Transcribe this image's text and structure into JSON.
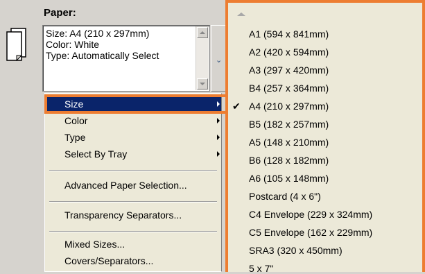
{
  "paper": {
    "label": "Paper:",
    "info_lines": [
      "Size: A4 (210 x 297mm)",
      "Color: White",
      "Type: Automatically Select"
    ]
  },
  "menu": {
    "items": [
      {
        "label": "Size",
        "submenu": true,
        "selected": true
      },
      {
        "label": "Color",
        "submenu": true
      },
      {
        "label": "Type",
        "submenu": true
      },
      {
        "label": "Select By Tray",
        "submenu": true
      },
      {
        "label": "Advanced Paper Selection..."
      },
      {
        "label": "Transparency Separators..."
      },
      {
        "label": "Mixed Sizes..."
      },
      {
        "label": "Covers/Separators..."
      }
    ]
  },
  "size_submenu": {
    "items": [
      {
        "label": "A1 (594 x 841mm)"
      },
      {
        "label": "A2 (420 x 594mm)"
      },
      {
        "label": "A3 (297 x 420mm)"
      },
      {
        "label": "B4 (257 x 364mm)"
      },
      {
        "label": "A4 (210 x 297mm)",
        "checked": true
      },
      {
        "label": "B5 (182 x 257mm)"
      },
      {
        "label": "A5 (148 x 210mm)"
      },
      {
        "label": "B6 (128 x 182mm)"
      },
      {
        "label": "A6 (105 x 148mm)"
      },
      {
        "label": "Postcard (4 x 6\")"
      },
      {
        "label": "C4 Envelope (229 x 324mm)"
      },
      {
        "label": "C5 Envelope (162 x 229mm)"
      },
      {
        "label": "SRA3 (320 x 450mm)"
      },
      {
        "label": "5 x 7\""
      }
    ]
  },
  "colors": {
    "highlight": "#ed7d31",
    "selection": "#0a246a"
  },
  "icons": [
    "document-icon",
    "scroll-up-icon",
    "scroll-down-icon",
    "dropdown-chevron-icon",
    "submenu-arrow-icon",
    "scroll-up-arrow-icon",
    "checkmark-icon"
  ]
}
